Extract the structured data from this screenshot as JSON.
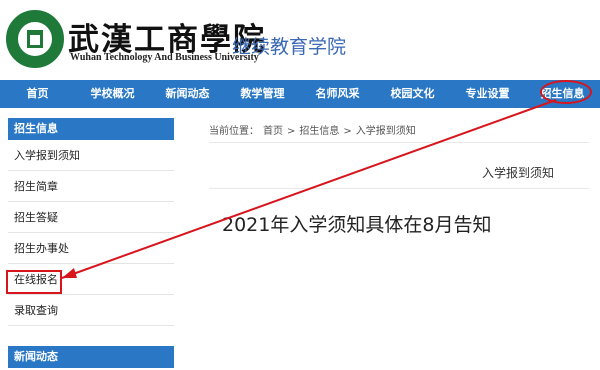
{
  "header": {
    "school_name": "武漢工商學院",
    "school_name_en": "Wuhan Technology And Business University",
    "college": "继续教育学院"
  },
  "nav": {
    "items": [
      "首页",
      "学校概况",
      "新闻动态",
      "教学管理",
      "名师风采",
      "校园文化",
      "专业设置",
      "招生信息"
    ]
  },
  "sidebar": {
    "section_title": "招生信息",
    "items": [
      "入学报到须知",
      "招生简章",
      "招生答疑",
      "招生办事处",
      "在线报名",
      "录取查询"
    ],
    "next_section_title": "新闻动态"
  },
  "breadcrumb": {
    "prefix": "当前位置：",
    "items": [
      "首页",
      "招生信息",
      "入学报到须知"
    ],
    "separator": ">"
  },
  "article": {
    "label": "入学报到须知",
    "title": "2021年入学须知具体在8月告知"
  },
  "colors": {
    "nav_blue": "#2a78c5",
    "annotation_red": "#d8141c",
    "logo_green": "#1f7a3a"
  }
}
